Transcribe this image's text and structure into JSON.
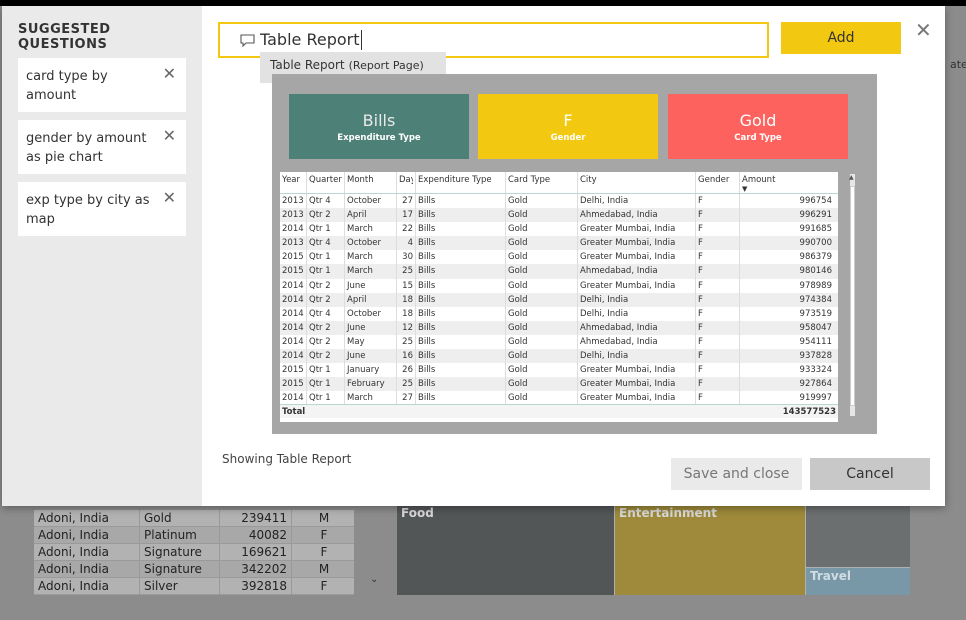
{
  "background": {
    "side_text": "ate",
    "table_rows": [
      {
        "city": "Adoni, India",
        "card": "Gold",
        "amount": "239411",
        "gender": "M"
      },
      {
        "city": "Adoni, India",
        "card": "Platinum",
        "amount": "40082",
        "gender": "F"
      },
      {
        "city": "Adoni, India",
        "card": "Signature",
        "amount": "169621",
        "gender": "F"
      },
      {
        "city": "Adoni, India",
        "card": "Signature",
        "amount": "342202",
        "gender": "M"
      },
      {
        "city": "Adoni, India",
        "card": "Silver",
        "amount": "392818",
        "gender": "F"
      }
    ],
    "treemap": {
      "food": "Food",
      "entertainment": "Entertainment",
      "travel": "Travel"
    }
  },
  "sidebar": {
    "title": "SUGGESTED QUESTIONS",
    "questions": [
      "card type by amount",
      "gender by amount as pie chart",
      "exp type by city as map"
    ]
  },
  "question": {
    "value": "Table Report",
    "suggestion": "Table Report",
    "suggestion_sub": "(Report Page)"
  },
  "buttons": {
    "add": "Add",
    "save": "Save and close",
    "cancel": "Cancel"
  },
  "cards": [
    {
      "value": "Bills",
      "label": "Expenditure Type"
    },
    {
      "value": "F",
      "label": "Gender"
    },
    {
      "value": "Gold",
      "label": "Card Type"
    }
  ],
  "table": {
    "headers": [
      "Year",
      "Quarter",
      "Month",
      "Day",
      "Expenditure Type",
      "Card Type",
      "City",
      "Gender",
      "Amount"
    ],
    "rows": [
      [
        "2013",
        "Qtr 4",
        "October",
        "27",
        "Bills",
        "Gold",
        "Delhi, India",
        "F",
        "996754"
      ],
      [
        "2013",
        "Qtr 2",
        "April",
        "17",
        "Bills",
        "Gold",
        "Ahmedabad, India",
        "F",
        "996291"
      ],
      [
        "2014",
        "Qtr 1",
        "March",
        "22",
        "Bills",
        "Gold",
        "Greater Mumbai, India",
        "F",
        "991685"
      ],
      [
        "2013",
        "Qtr 4",
        "October",
        "4",
        "Bills",
        "Gold",
        "Greater Mumbai, India",
        "F",
        "990700"
      ],
      [
        "2015",
        "Qtr 1",
        "March",
        "30",
        "Bills",
        "Gold",
        "Greater Mumbai, India",
        "F",
        "986379"
      ],
      [
        "2015",
        "Qtr 1",
        "March",
        "25",
        "Bills",
        "Gold",
        "Ahmedabad, India",
        "F",
        "980146"
      ],
      [
        "2014",
        "Qtr 2",
        "June",
        "15",
        "Bills",
        "Gold",
        "Greater Mumbai, India",
        "F",
        "978989"
      ],
      [
        "2014",
        "Qtr 2",
        "April",
        "18",
        "Bills",
        "Gold",
        "Delhi, India",
        "F",
        "974384"
      ],
      [
        "2014",
        "Qtr 4",
        "October",
        "18",
        "Bills",
        "Gold",
        "Delhi, India",
        "F",
        "973519"
      ],
      [
        "2014",
        "Qtr 2",
        "June",
        "12",
        "Bills",
        "Gold",
        "Ahmedabad, India",
        "F",
        "958047"
      ],
      [
        "2014",
        "Qtr 2",
        "May",
        "25",
        "Bills",
        "Gold",
        "Ahmedabad, India",
        "F",
        "954111"
      ],
      [
        "2014",
        "Qtr 2",
        "June",
        "16",
        "Bills",
        "Gold",
        "Delhi, India",
        "F",
        "937828"
      ],
      [
        "2015",
        "Qtr 1",
        "January",
        "26",
        "Bills",
        "Gold",
        "Greater Mumbai, India",
        "F",
        "933324"
      ],
      [
        "2015",
        "Qtr 1",
        "February",
        "25",
        "Bills",
        "Gold",
        "Greater Mumbai, India",
        "F",
        "927864"
      ],
      [
        "2014",
        "Qtr 1",
        "March",
        "27",
        "Bills",
        "Gold",
        "Greater Mumbai, India",
        "F",
        "919997"
      ]
    ],
    "total_label": "Total",
    "total_value": "143577523"
  },
  "status": "Showing Table Report",
  "colors": {
    "accent": "#f2c811",
    "teal": "#4d8077",
    "coral": "#fd625e"
  }
}
